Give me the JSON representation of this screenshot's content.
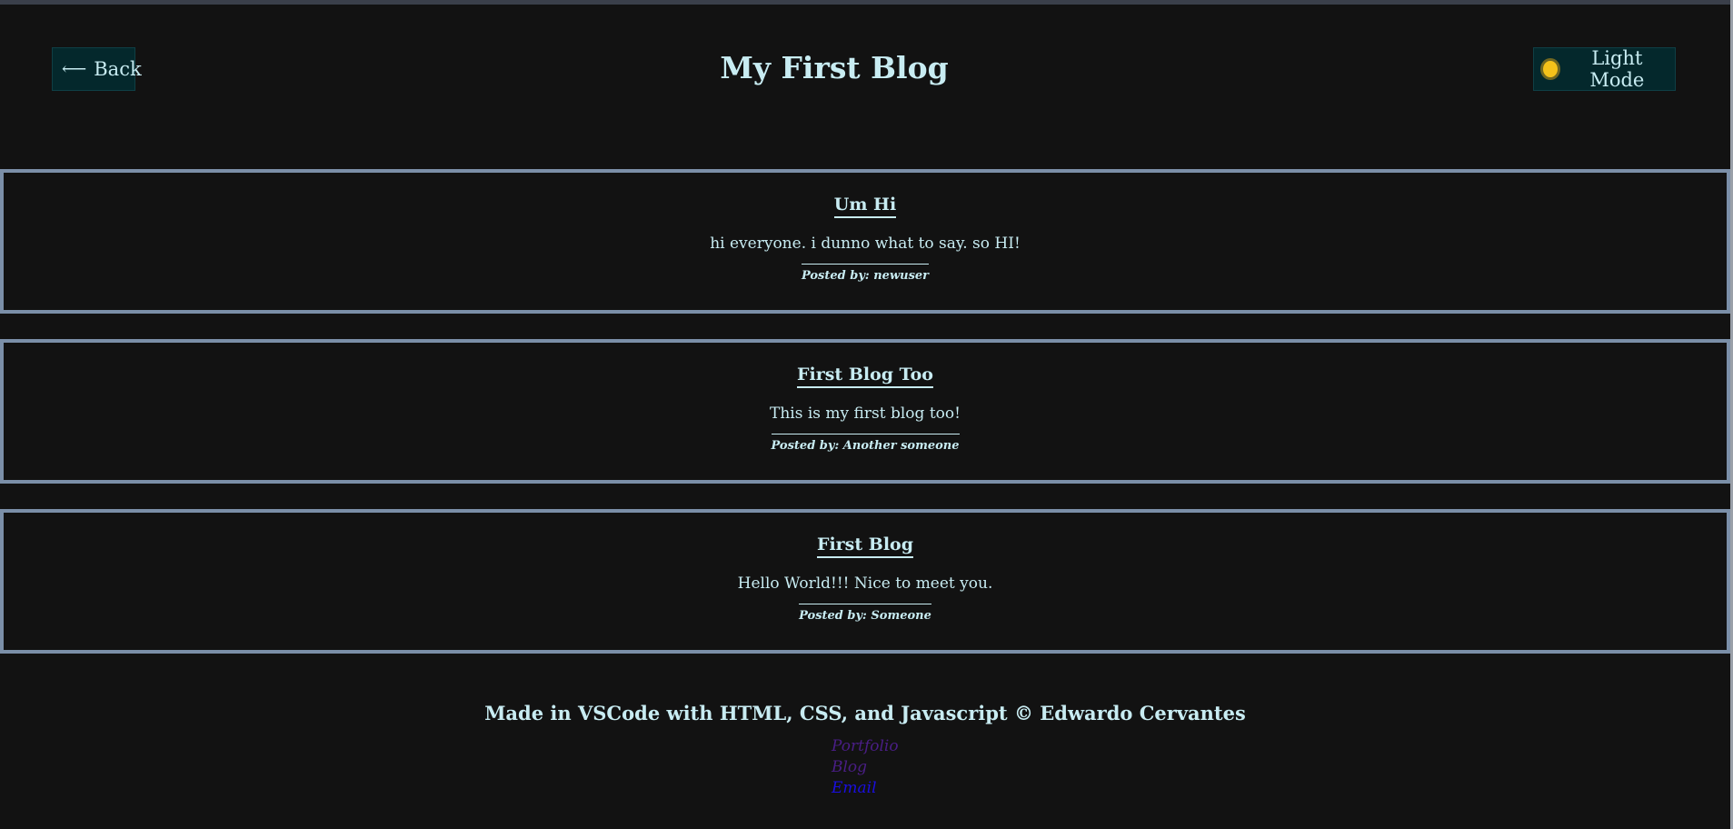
{
  "header": {
    "back_label": "Back",
    "back_icon": "arrow-left-icon",
    "title": "My First Blog",
    "theme_label": "Light Mode",
    "theme_icon": "sun-icon"
  },
  "posts": [
    {
      "title": "Um Hi",
      "body": "hi everyone. i dunno what to say. so HI!",
      "author": "Posted by: newuser"
    },
    {
      "title": "First Blog Too",
      "body": "This is my first blog too!",
      "author": "Posted by: Another someone"
    },
    {
      "title": "First Blog",
      "body": "Hello World!!! Nice to meet you.",
      "author": "Posted by: Someone"
    }
  ],
  "footer": {
    "text": "Made in VSCode with HTML, CSS, and Javascript © Edwardo Cervantes",
    "links": [
      "Portfolio",
      "Blog",
      "Email"
    ]
  },
  "colors": {
    "background": "#121212",
    "text": "#c8ecf2",
    "button_bg": "#04282c",
    "post_border": "#7b8fa8",
    "visited_link": "#4a1e86",
    "email_link": "#1a0ee0"
  }
}
